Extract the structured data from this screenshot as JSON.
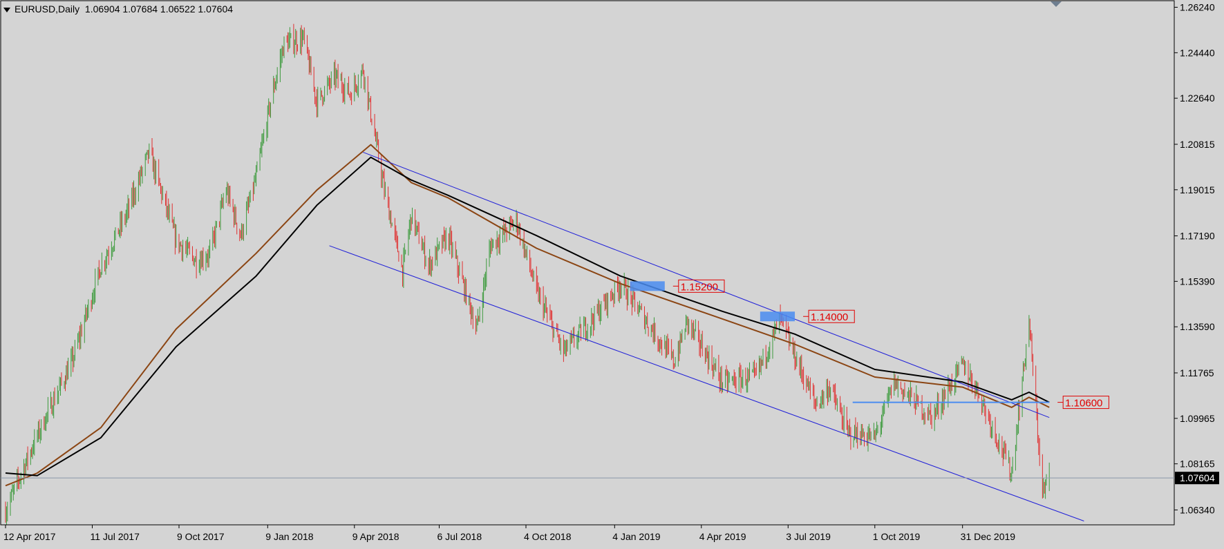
{
  "header": {
    "symbol": "EURUSD,Daily",
    "open": "1.06904",
    "high": "1.07684",
    "low": "1.06522",
    "close": "1.07604"
  },
  "colors": {
    "background": "#d4d4d4",
    "bull_candle": "#3c9a3c",
    "bear_candle": "#e03030",
    "ma_fast": "#8b4513",
    "ma_slow": "#000000",
    "channel": "#1e1ed8",
    "level_line": "#4a8cf0",
    "label_text": "#e00000",
    "current_price_bg": "#000000"
  },
  "chart_data": {
    "type": "candlestick",
    "symbol": "EURUSD",
    "timeframe": "Daily",
    "y_ticks": [
      "1.26240",
      "1.24440",
      "1.22640",
      "1.20815",
      "1.19015",
      "1.17190",
      "1.15390",
      "1.13590",
      "1.11765",
      "1.09965",
      "1.08165",
      "1.06340"
    ],
    "ylim": [
      1.0575,
      1.265
    ],
    "x_ticks": [
      "12 Apr 2017",
      "11 Jul 2017",
      "9 Oct 2017",
      "9 Jan 2018",
      "9 Apr 2018",
      "6 Jul 2018",
      "4 Oct 2018",
      "4 Jan 2019",
      "4 Apr 2019",
      "3 Jul 2019",
      "1 Oct 2019",
      "31 Dec 2019"
    ],
    "current_price": "1.07604",
    "price_path": [
      {
        "date": "2017-04-12",
        "price": 1.063
      },
      {
        "date": "2017-05-15",
        "price": 1.093
      },
      {
        "date": "2017-06-20",
        "price": 1.122
      },
      {
        "date": "2017-07-20",
        "price": 1.16
      },
      {
        "date": "2017-08-15",
        "price": 1.18
      },
      {
        "date": "2017-09-08",
        "price": 1.205
      },
      {
        "date": "2017-10-06",
        "price": 1.17
      },
      {
        "date": "2017-10-27",
        "price": 1.162
      },
      {
        "date": "2017-11-10",
        "price": 1.165
      },
      {
        "date": "2017-11-27",
        "price": 1.19
      },
      {
        "date": "2017-12-12",
        "price": 1.172
      },
      {
        "date": "2017-12-28",
        "price": 1.195
      },
      {
        "date": "2018-01-12",
        "price": 1.225
      },
      {
        "date": "2018-01-26",
        "price": 1.248
      },
      {
        "date": "2018-02-15",
        "price": 1.25
      },
      {
        "date": "2018-03-01",
        "price": 1.225
      },
      {
        "date": "2018-03-20",
        "price": 1.235
      },
      {
        "date": "2018-04-05",
        "price": 1.228
      },
      {
        "date": "2018-04-18",
        "price": 1.238
      },
      {
        "date": "2018-05-10",
        "price": 1.19
      },
      {
        "date": "2018-05-29",
        "price": 1.158
      },
      {
        "date": "2018-06-07",
        "price": 1.18
      },
      {
        "date": "2018-06-25",
        "price": 1.16
      },
      {
        "date": "2018-07-15",
        "price": 1.172
      },
      {
        "date": "2018-08-14",
        "price": 1.135
      },
      {
        "date": "2018-08-28",
        "price": 1.168
      },
      {
        "date": "2018-09-24",
        "price": 1.178
      },
      {
        "date": "2018-10-15",
        "price": 1.15
      },
      {
        "date": "2018-11-12",
        "price": 1.126
      },
      {
        "date": "2018-12-10",
        "price": 1.138
      },
      {
        "date": "2019-01-10",
        "price": 1.153
      },
      {
        "date": "2019-01-30",
        "price": 1.142
      },
      {
        "date": "2019-03-07",
        "price": 1.122
      },
      {
        "date": "2019-03-20",
        "price": 1.138
      },
      {
        "date": "2019-04-26",
        "price": 1.114
      },
      {
        "date": "2019-05-30",
        "price": 1.116
      },
      {
        "date": "2019-06-25",
        "price": 1.139
      },
      {
        "date": "2019-07-10",
        "price": 1.124
      },
      {
        "date": "2019-08-01",
        "price": 1.105
      },
      {
        "date": "2019-08-15",
        "price": 1.112
      },
      {
        "date": "2019-09-03",
        "price": 1.094
      },
      {
        "date": "2019-10-01",
        "price": 1.092
      },
      {
        "date": "2019-10-21",
        "price": 1.114
      },
      {
        "date": "2019-11-29",
        "price": 1.1
      },
      {
        "date": "2019-12-31",
        "price": 1.121
      },
      {
        "date": "2020-01-14",
        "price": 1.112
      },
      {
        "date": "2020-02-20",
        "price": 1.078
      },
      {
        "date": "2020-03-09",
        "price": 1.138
      },
      {
        "date": "2020-03-23",
        "price": 1.07
      },
      {
        "date": "2020-03-30",
        "price": 1.076
      }
    ],
    "ma_fast": [
      {
        "date": "2017-04-12",
        "value": 1.073
      },
      {
        "date": "2017-05-15",
        "value": 1.078
      },
      {
        "date": "2017-07-20",
        "value": 1.096
      },
      {
        "date": "2017-10-06",
        "value": 1.135
      },
      {
        "date": "2017-12-28",
        "value": 1.165
      },
      {
        "date": "2018-03-01",
        "value": 1.19
      },
      {
        "date": "2018-04-26",
        "value": 1.208
      },
      {
        "date": "2018-06-07",
        "value": 1.193
      },
      {
        "date": "2018-07-15",
        "value": 1.187
      },
      {
        "date": "2018-10-15",
        "value": 1.167
      },
      {
        "date": "2019-01-10",
        "value": 1.153
      },
      {
        "date": "2019-04-26",
        "value": 1.139
      },
      {
        "date": "2019-07-10",
        "value": 1.129
      },
      {
        "date": "2019-10-01",
        "value": 1.116
      },
      {
        "date": "2019-12-31",
        "value": 1.112
      },
      {
        "date": "2020-02-20",
        "value": 1.104
      },
      {
        "date": "2020-03-09",
        "value": 1.108
      },
      {
        "date": "2020-03-30",
        "value": 1.104
      }
    ],
    "ma_slow": [
      {
        "date": "2017-04-12",
        "value": 1.078
      },
      {
        "date": "2017-05-15",
        "value": 1.077
      },
      {
        "date": "2017-07-20",
        "value": 1.092
      },
      {
        "date": "2017-10-06",
        "value": 1.128
      },
      {
        "date": "2017-12-28",
        "value": 1.156
      },
      {
        "date": "2018-03-01",
        "value": 1.184
      },
      {
        "date": "2018-04-26",
        "value": 1.203
      },
      {
        "date": "2018-06-07",
        "value": 1.194
      },
      {
        "date": "2018-07-15",
        "value": 1.188
      },
      {
        "date": "2018-10-15",
        "value": 1.172
      },
      {
        "date": "2019-01-10",
        "value": 1.156
      },
      {
        "date": "2019-04-26",
        "value": 1.142
      },
      {
        "date": "2019-07-10",
        "value": 1.133
      },
      {
        "date": "2019-10-01",
        "value": 1.119
      },
      {
        "date": "2019-12-31",
        "value": 1.114
      },
      {
        "date": "2020-02-20",
        "value": 1.107
      },
      {
        "date": "2020-03-09",
        "value": 1.11
      },
      {
        "date": "2020-03-30",
        "value": 1.106
      }
    ],
    "channel_upper": [
      {
        "date": "2018-04-18",
        "price": 1.205
      },
      {
        "date": "2020-03-30",
        "price": 1.1
      }
    ],
    "channel_lower": [
      {
        "date": "2018-03-14",
        "price": 1.168
      },
      {
        "date": "2020-05-05",
        "price": 1.059
      }
    ],
    "levels": [
      {
        "label": "1.15200",
        "price": 1.152,
        "zone_from": "2019-01-20",
        "zone_to": "2019-02-25",
        "line": false
      },
      {
        "label": "1.14000",
        "price": 1.14,
        "zone_from": "2019-06-04",
        "zone_to": "2019-07-10",
        "line": false
      },
      {
        "label": "1.10600",
        "price": 1.106,
        "line_from": "2019-09-08",
        "line_to": "2020-03-30",
        "line": true
      }
    ]
  }
}
